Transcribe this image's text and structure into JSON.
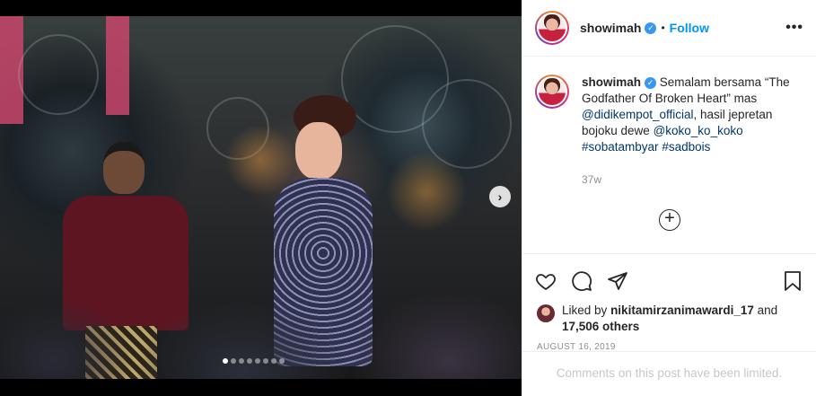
{
  "post": {
    "username": "showimah",
    "verified_icon": "verified-badge-icon",
    "follow_label": "Follow",
    "separator": "•",
    "more_label": "•••"
  },
  "caption": {
    "username": "showimah",
    "text_1": "Semalam bersama “The Godfather Of Broken Heart” mas",
    "mention_1": "@didikempot_official",
    "text_2": ", hasil jepretan bojoku dewe",
    "mention_2": "@koko_ko_koko",
    "hashtag_1": "#sobatambyar",
    "hashtag_2": "#sadbois",
    "time_ago": "37w",
    "load_more_symbol": "+"
  },
  "likes": {
    "prefix": "Liked by",
    "user": "nikitamirzanimawardi_17",
    "and": "and",
    "count": "17,506 others"
  },
  "date": "AUGUST 16, 2019",
  "comments_notice": "Comments on this post have been limited.",
  "carousel": {
    "next_symbol": "›",
    "slide_count": 8,
    "active_slide": 1
  },
  "colors": {
    "accent": "#0095f6",
    "verified": "#3897f0",
    "text": "#262626",
    "muted": "#8e8e8e"
  }
}
